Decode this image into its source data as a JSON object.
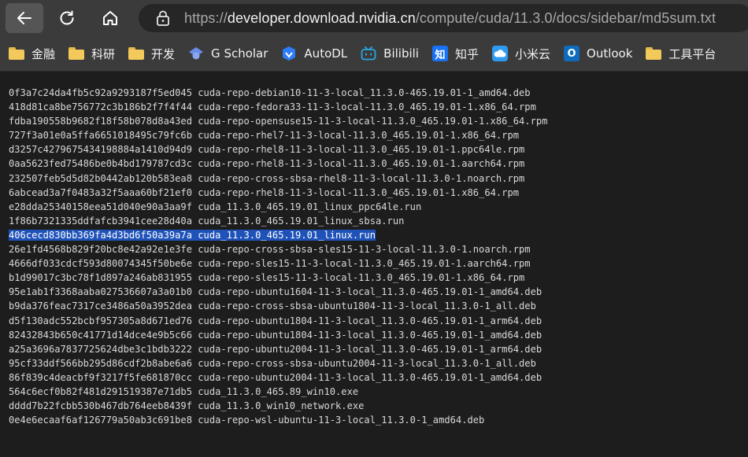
{
  "browser": {
    "url_prefix": "https://",
    "url_host": "developer.download.nvidia.cn",
    "url_path": "/compute/cuda/11.3.0/docs/sidebar/md5sum.txt",
    "icons": {
      "back": "arrow-left-icon",
      "reload": "reload-icon",
      "home": "home-icon",
      "lock": "lock-icon"
    }
  },
  "bookmarks": [
    {
      "label": "金融",
      "icon": "folder-icon"
    },
    {
      "label": "科研",
      "icon": "folder-icon"
    },
    {
      "label": "开发",
      "icon": "folder-icon"
    },
    {
      "label": "G Scholar",
      "icon": "scholar-cap-icon"
    },
    {
      "label": "AutoDL",
      "icon": "autodl-logo-icon"
    },
    {
      "label": "Bilibili",
      "icon": "bilibili-tv-icon"
    },
    {
      "label": "知乎",
      "icon": "zhihu-logo-icon",
      "badge": "知"
    },
    {
      "label": "小米云",
      "icon": "cloud-icon"
    },
    {
      "label": "Outlook",
      "icon": "outlook-logo-icon",
      "badge": "O"
    },
    {
      "label": "工具平台",
      "icon": "folder-icon"
    }
  ],
  "file": {
    "selected_index": 11,
    "lines": [
      {
        "md5": "0f3a7c24da4fb5c92a9293187f5ed045",
        "name": "cuda-repo-debian10-11-3-local_11.3.0-465.19.01-1_amd64.deb"
      },
      {
        "md5": "418d81ca8be756772c3b186b2f7f4f44",
        "name": "cuda-repo-fedora33-11-3-local-11.3.0_465.19.01-1.x86_64.rpm"
      },
      {
        "md5": "fdba190558b9682f18f58b078d8a43ed",
        "name": "cuda-repo-opensuse15-11-3-local-11.3.0_465.19.01-1.x86_64.rpm"
      },
      {
        "md5": "727f3a01e0a5ffa6651018495c79fc6b",
        "name": "cuda-repo-rhel7-11-3-local-11.3.0_465.19.01-1.x86_64.rpm"
      },
      {
        "md5": "d3257c4279675434198884a1410d94d9",
        "name": "cuda-repo-rhel8-11-3-local-11.3.0_465.19.01-1.ppc64le.rpm"
      },
      {
        "md5": "0aa5623fed75486be0b4bd179787cd3c",
        "name": "cuda-repo-rhel8-11-3-local-11.3.0_465.19.01-1.aarch64.rpm"
      },
      {
        "md5": "232507feb5d5d82b0442ab120b583ea8",
        "name": "cuda-repo-cross-sbsa-rhel8-11-3-local-11.3.0-1.noarch.rpm"
      },
      {
        "md5": "6abcead3a7f0483a32f5aaa60bf21ef0",
        "name": "cuda-repo-rhel8-11-3-local-11.3.0_465.19.01-1.x86_64.rpm"
      },
      {
        "md5": "e28dda25340158eea51d040e90a3aa9f",
        "name": "cuda_11.3.0_465.19.01_linux_ppc64le.run"
      },
      {
        "md5": "1f86b7321335ddfafcb3941cee28d40a",
        "name": "cuda_11.3.0_465.19.01_linux_sbsa.run"
      },
      {
        "md5": "406cecd830bb369fa4d3bd6f50a39a7a",
        "name": "cuda_11.3.0_465.19.01_linux.run"
      },
      {
        "md5": "26e1fd4568b829f20bc8e42a92e1e3fe",
        "name": "cuda-repo-cross-sbsa-sles15-11-3-local-11.3.0-1.noarch.rpm"
      },
      {
        "md5": "4666df033cdcf593d80074345f50be6e",
        "name": "cuda-repo-sles15-11-3-local-11.3.0_465.19.01-1.aarch64.rpm"
      },
      {
        "md5": "b1d99017c3bc78f1d897a246ab831955",
        "name": "cuda-repo-sles15-11-3-local-11.3.0_465.19.01-1.x86_64.rpm"
      },
      {
        "md5": "95e1ab1f3368aaba027536607a3a01b0",
        "name": "cuda-repo-ubuntu1604-11-3-local_11.3.0-465.19.01-1_amd64.deb"
      },
      {
        "md5": "b9da376feac7317ce3486a50a3952dea",
        "name": "cuda-repo-cross-sbsa-ubuntu1804-11-3-local_11.3.0-1_all.deb"
      },
      {
        "md5": "d5f130adc552bcbf957305a8d671ed76",
        "name": "cuda-repo-ubuntu1804-11-3-local_11.3.0-465.19.01-1_arm64.deb"
      },
      {
        "md5": "82432843b650c41771d14dce4e9b5c66",
        "name": "cuda-repo-ubuntu1804-11-3-local_11.3.0-465.19.01-1_amd64.deb"
      },
      {
        "md5": "a25a3696a7837725624dbe3c1bdb3222",
        "name": "cuda-repo-ubuntu2004-11-3-local_11.3.0-465.19.01-1_arm64.deb"
      },
      {
        "md5": "95cf33ddf566bb295d86cdf2b8abe6a6",
        "name": "cuda-repo-cross-sbsa-ubuntu2004-11-3-local_11.3.0-1_all.deb"
      },
      {
        "md5": "86f839c4deacbf9f3217f5fe681870cc",
        "name": "cuda-repo-ubuntu2004-11-3-local_11.3.0-465.19.01-1_amd64.deb"
      },
      {
        "md5": "564c6ecf0b82f481d291519387e71db5",
        "name": "cuda_11.3.0_465.89_win10.exe"
      },
      {
        "md5": "dddd7b22fcbb530b467db764eeb8439f",
        "name": "cuda_11.3.0_win10_network.exe"
      },
      {
        "md5": "0e4e6ecaaf6af126779a50ab3c691be8",
        "name": "cuda-repo-wsl-ubuntu-11-3-local_11.3.0-1_amd64.deb"
      }
    ]
  },
  "colors": {
    "toolbar_bg": "#3b3b3b",
    "page_bg": "#1d1d1d",
    "text": "#d8d8d8",
    "selection": "#1f52b8"
  }
}
